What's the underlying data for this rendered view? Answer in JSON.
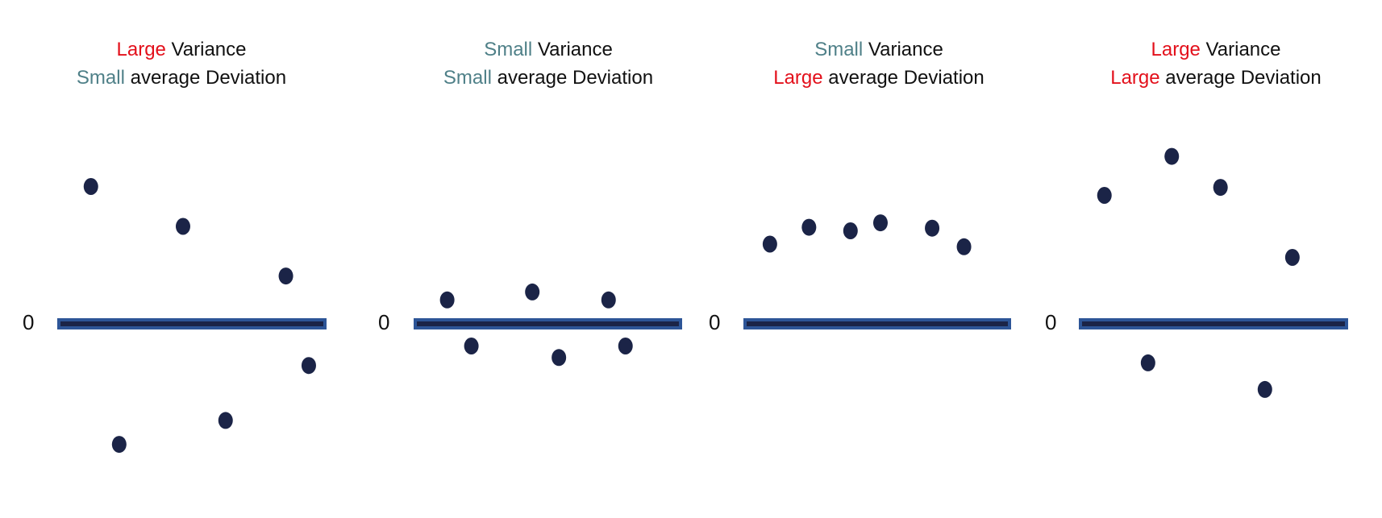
{
  "colors": {
    "large": "#e3101b",
    "small": "#4f8088",
    "point": "#1b2447",
    "axis_outer": "#2d5597",
    "axis_inner": "#1b2447"
  },
  "chart_data": [
    {
      "type": "scatter",
      "title_lines": [
        {
          "qualifier": "Large",
          "rest": " Variance"
        },
        {
          "qualifier": "Small",
          "rest": " average Deviation"
        }
      ],
      "zero_label": "0",
      "x": [
        1.25,
        2.3,
        4.67,
        6.25,
        8.49,
        9.34
      ],
      "y": [
        15.5,
        -13.6,
        11,
        -10.9,
        5.4,
        -4.7
      ],
      "xlim": [
        0,
        10
      ],
      "ylim": [
        -18,
        18
      ]
    },
    {
      "type": "scatter",
      "title_lines": [
        {
          "qualifier": "Small",
          "rest": " Variance"
        },
        {
          "qualifier": "Small",
          "rest": " average Deviation"
        }
      ],
      "zero_label": "0",
      "x": [
        1.25,
        2.15,
        4.42,
        5.41,
        7.26,
        7.89
      ],
      "y": [
        2.7,
        -2.5,
        3.6,
        -3.8,
        2.7,
        -2.5
      ],
      "xlim": [
        0,
        10
      ],
      "ylim": [
        -18,
        18
      ]
    },
    {
      "type": "scatter",
      "title_lines": [
        {
          "qualifier": "Small",
          "rest": " Variance"
        },
        {
          "qualifier": "Large",
          "rest": " average Deviation"
        }
      ],
      "zero_label": "0",
      "x": [
        0.99,
        2.45,
        4.0,
        5.12,
        7.05,
        8.24
      ],
      "y": [
        9.0,
        10.9,
        10.5,
        11.4,
        10.8,
        8.7
      ],
      "xlim": [
        0,
        10
      ],
      "ylim": [
        -18,
        18
      ]
    },
    {
      "type": "scatter",
      "title_lines": [
        {
          "qualifier": "Large",
          "rest": " Variance"
        },
        {
          "qualifier": "Large",
          "rest": " average Deviation"
        }
      ],
      "zero_label": "0",
      "x": [
        0.95,
        2.57,
        3.45,
        5.26,
        6.91,
        7.93
      ],
      "y": [
        14.5,
        -4.4,
        18.9,
        15.4,
        -7.4,
        7.5
      ],
      "xlim": [
        0,
        10
      ],
      "ylim": [
        -18,
        18
      ]
    }
  ]
}
